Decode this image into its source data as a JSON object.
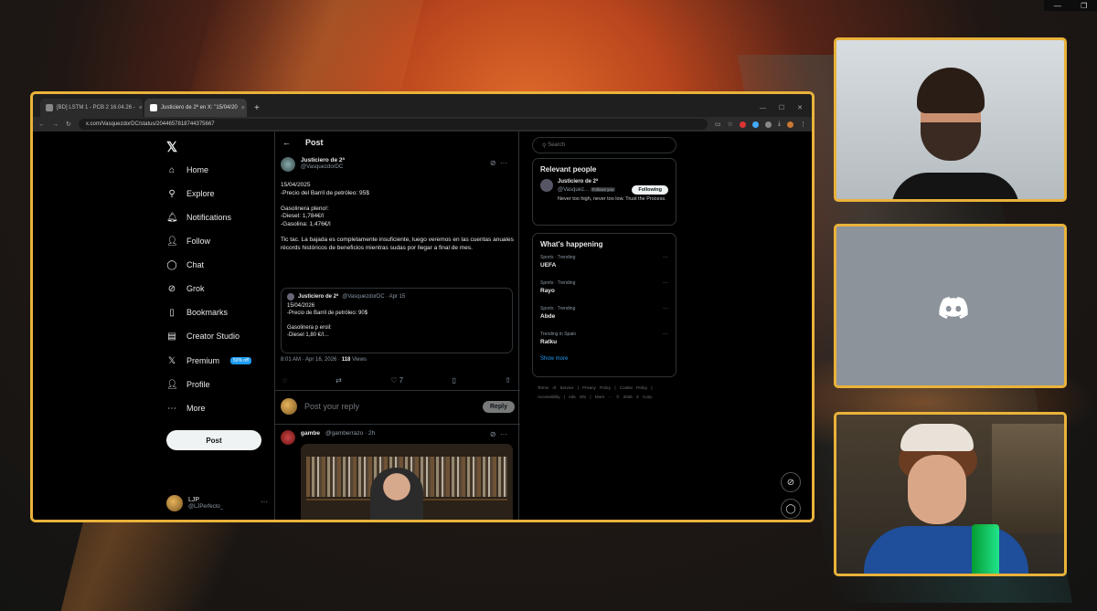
{
  "browser": {
    "tabs": [
      {
        "label": "[BD] LSTM 1 - PCB 2 16.04.26 -",
        "active": false
      },
      {
        "label": "Justiciero de 2ª en X: \"15/04/20",
        "active": true
      }
    ],
    "new_tab": "+",
    "url": "x.com/VasquezdorDC/status/2044657818744375667"
  },
  "x": {
    "nav": [
      {
        "icon": "home-icon",
        "glyph": "⌂",
        "label": "Home"
      },
      {
        "icon": "search-icon",
        "glyph": "⚲",
        "label": "Explore"
      },
      {
        "icon": "bell-icon",
        "glyph": "🔔︎",
        "label": "Notifications"
      },
      {
        "icon": "follow-icon",
        "glyph": "👤︎",
        "label": "Follow"
      },
      {
        "icon": "chat-icon",
        "glyph": "◯",
        "label": "Chat"
      },
      {
        "icon": "grok-icon",
        "glyph": "⊘",
        "label": "Grok"
      },
      {
        "icon": "bookmark-icon",
        "glyph": "▯",
        "label": "Bookmarks"
      },
      {
        "icon": "creator-studio-icon",
        "glyph": "▤",
        "label": "Creator Studio"
      },
      {
        "icon": "premium-icon",
        "glyph": "𝕏",
        "label": "Premium"
      },
      {
        "icon": "profile-icon",
        "glyph": "👤︎",
        "label": "Profile"
      },
      {
        "icon": "more-icon",
        "glyph": "⋯",
        "label": "More"
      }
    ],
    "premium_badge": "50% off",
    "post_button": "Post",
    "me": {
      "name": "LJP",
      "handle": "@LJPerfecto_"
    },
    "header_title": "Post",
    "post": {
      "author": "Justiciero de 2ª",
      "handle": "@VasquezdorDC",
      "lines": [
        "15/04/2025",
        "-Precio del Barril de petróleo: 95$",
        "",
        "Gasolinera pleno!:",
        "-Diesel: 1,784€/l",
        "-Gasolina: 1,476€/l",
        "",
        "Tic tac. La bajada es completamente insuficiente, luego veremos en las cuentas anuales récords históricos de beneficios mientras sudas por llegar a final de mes."
      ],
      "quote": {
        "author": "Justiciero de 2ª",
        "handle": "@VasquezdorDC · Apr 15",
        "lines": [
          "15/04/2026",
          "-Precio de Barril de petróleo: 90$",
          "",
          "Gasolinera p eroil:",
          "-Diesel 1,80 €/l…"
        ]
      },
      "time": "8:01 AM · Apr 16, 2026 ·",
      "views": "118",
      "views_label": "Views",
      "likes": "7"
    },
    "reply_placeholder": "Post your reply",
    "reply_button": "Reply",
    "reply2": {
      "author": "gambe",
      "handle": "@gamberrazo · 2h"
    },
    "search_placeholder": "Search",
    "relevant": {
      "title": "Relevant people",
      "name": "Justiciero de 2ª",
      "handle": "@Vasquez...",
      "follows_you": "Follows you",
      "follow_button": "Following",
      "bio": "Never too high, never too low. Trust the Process."
    },
    "happening": {
      "title": "What's happening",
      "trends": [
        {
          "category": "Sports · Trending",
          "topic": "UEFA"
        },
        {
          "category": "Sports · Trending",
          "topic": "Rayo"
        },
        {
          "category": "Sports · Trending",
          "topic": "Abde"
        },
        {
          "category": "Trending in Spain",
          "topic": "Ratku"
        }
      ],
      "show_more": "Show more"
    },
    "footer": "Terms of Service | Privacy Policy | Cookie Policy | Accessibility | Ads info | More ··· © 2026 X Corp."
  },
  "colors": {
    "frame": "#e9b23a",
    "accent": "#1d9bf0"
  }
}
